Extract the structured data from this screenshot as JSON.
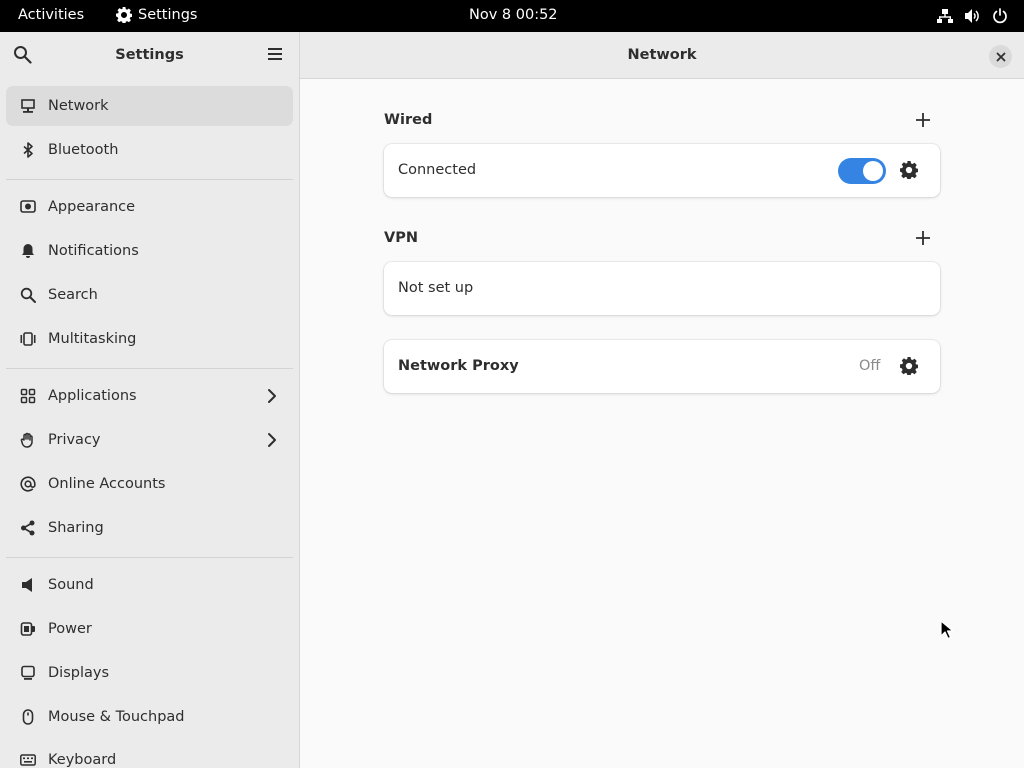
{
  "topbar": {
    "activities": "Activities",
    "app_name": "Settings",
    "clock": "Nov 8  00:52",
    "tray_icons": [
      "network-wired-icon",
      "volume-icon",
      "power-icon"
    ]
  },
  "sidebar": {
    "title": "Settings",
    "items": [
      {
        "label": "Network",
        "icon": "network-icon",
        "active": true
      },
      {
        "label": "Bluetooth",
        "icon": "bluetooth-icon"
      },
      {
        "label": "Appearance",
        "icon": "appearance-icon"
      },
      {
        "label": "Notifications",
        "icon": "bell-icon"
      },
      {
        "label": "Search",
        "icon": "search-icon"
      },
      {
        "label": "Multitasking",
        "icon": "multitasking-icon"
      },
      {
        "label": "Applications",
        "icon": "grid-icon",
        "has_submenu": true
      },
      {
        "label": "Privacy",
        "icon": "hand-icon",
        "has_submenu": true
      },
      {
        "label": "Online Accounts",
        "icon": "at-icon"
      },
      {
        "label": "Sharing",
        "icon": "share-icon"
      },
      {
        "label": "Sound",
        "icon": "speaker-icon"
      },
      {
        "label": "Power",
        "icon": "power-plug-icon"
      },
      {
        "label": "Displays",
        "icon": "display-icon"
      },
      {
        "label": "Mouse & Touchpad",
        "icon": "mouse-icon"
      },
      {
        "label": "Keyboard",
        "icon": "keyboard-icon"
      }
    ]
  },
  "main": {
    "title": "Network",
    "wired": {
      "title": "Wired",
      "connection_label": "Connected",
      "enabled": true
    },
    "vpn": {
      "title": "VPN",
      "status": "Not set up"
    },
    "proxy": {
      "label": "Network Proxy",
      "status": "Off"
    }
  },
  "colors": {
    "accent": "#3584e4",
    "sidebar_bg": "#ebebeb",
    "content_bg": "#fafafa"
  }
}
